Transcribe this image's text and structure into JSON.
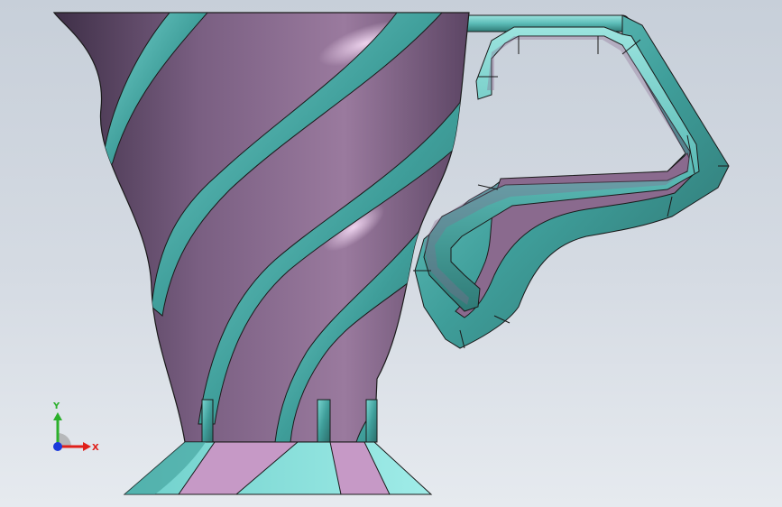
{
  "viewport": {
    "colors": {
      "purple": "#8a6a8e",
      "purple_dark": "#4f3a55",
      "purple_light": "#c699c6",
      "teal": "#3f9e9a",
      "teal_light": "#8fe0dc",
      "teal_dark": "#2b6d6a",
      "outline": "#1a1a1a"
    }
  },
  "triad": {
    "x_label": "X",
    "y_label": "Y",
    "x_color": "#e0201a",
    "y_color": "#2bb02b",
    "z_color": "#1a3adb"
  }
}
